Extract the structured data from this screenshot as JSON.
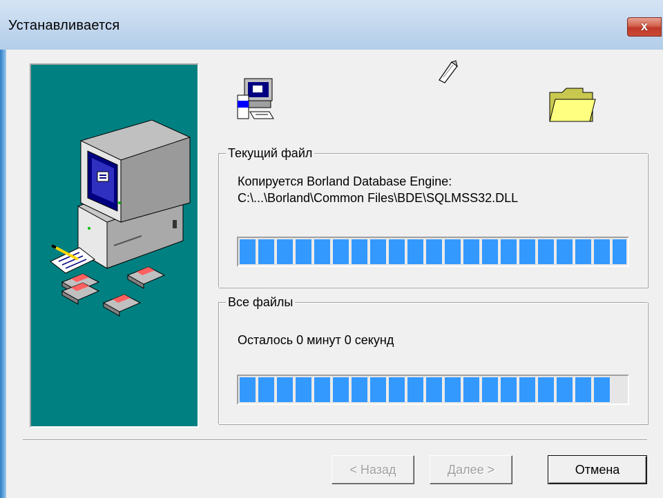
{
  "window": {
    "title": "Устанавливается",
    "close_label": "x"
  },
  "current_file": {
    "label": "Текущий файл",
    "line1": "Копируется Borland Database Engine:",
    "line2": "C:\\...\\Borland\\Common Files\\BDE\\SQLMSS32.DLL",
    "progress": 1.0
  },
  "all_files": {
    "label": "Все файлы",
    "remaining": "Осталось 0 минут 0 секунд",
    "progress": 0.96
  },
  "buttons": {
    "back": "< Назад",
    "next": "Далее >",
    "cancel": "Отмена"
  },
  "colors": {
    "side_panel": "#008080",
    "progress_fill": "#3399ff",
    "folder": "#ffff80",
    "close_button": "#c0392b"
  },
  "icons": {
    "source": "computer-setup-icon",
    "flying": "flying-paper-icon",
    "destination": "folder-icon"
  }
}
